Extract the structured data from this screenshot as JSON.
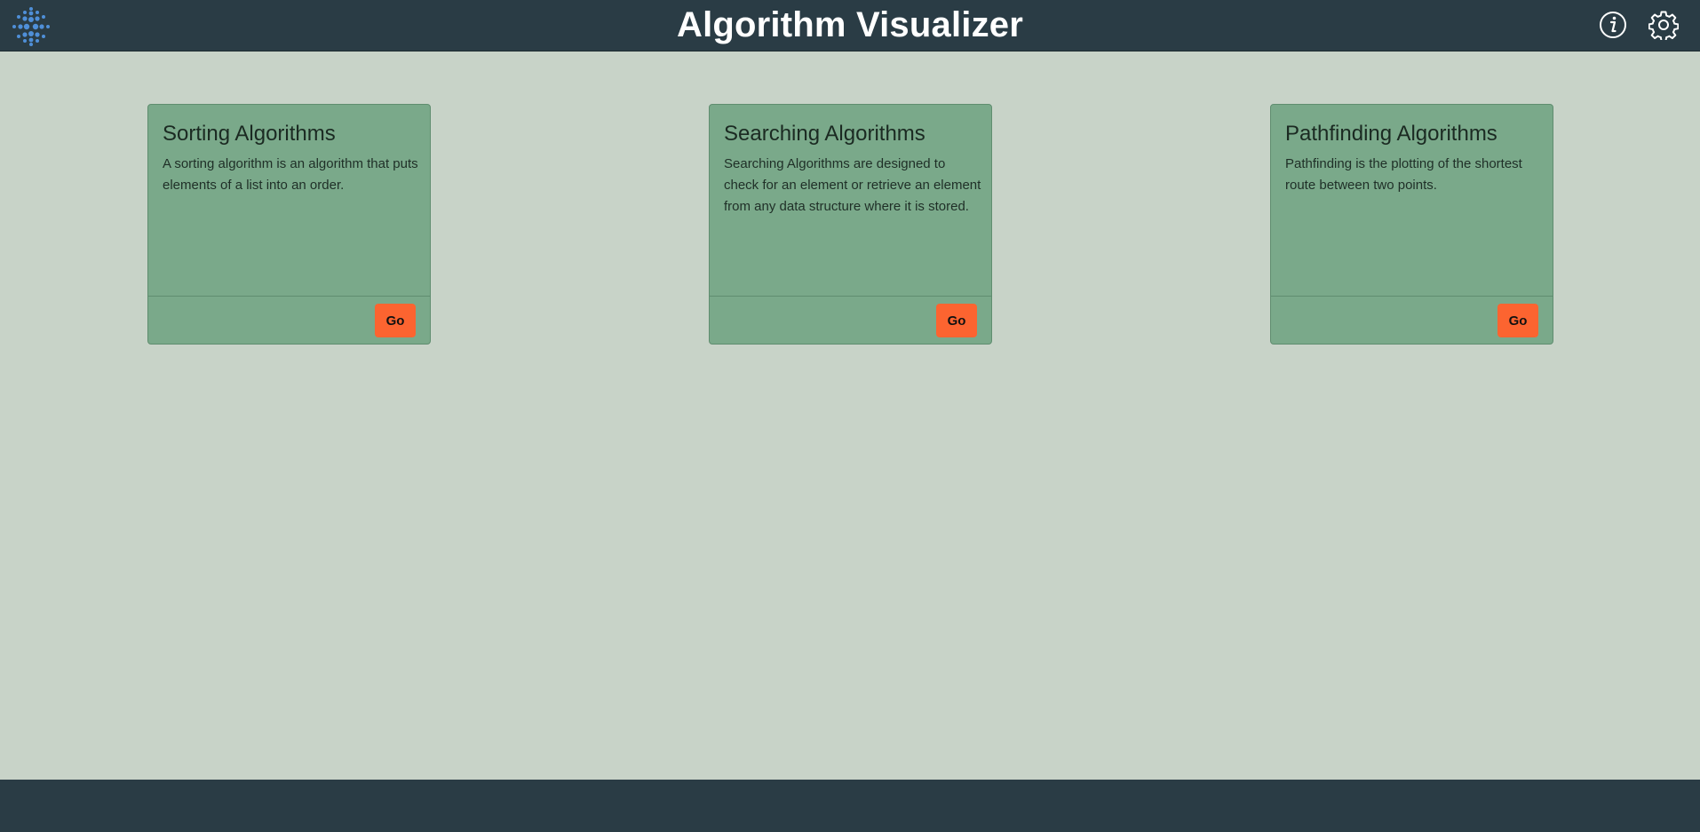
{
  "header": {
    "title": "Algorithm Visualizer",
    "logo_icon": "dot-grid-logo-icon",
    "info_icon": "info-icon",
    "settings_icon": "gear-icon"
  },
  "cards": [
    {
      "title": "Sorting Algorithms",
      "description": "A sorting algorithm is an algorithm that puts elements of a list into an order.",
      "button_label": "Go"
    },
    {
      "title": "Searching Algorithms",
      "description": "Searching Algorithms are designed to check for an element or retrieve an element from any data structure where it is stored.",
      "button_label": "Go"
    },
    {
      "title": "Pathfinding Algorithms",
      "description": "Pathfinding is the plotting of the shortest route between two points.",
      "button_label": "Go"
    }
  ],
  "colors": {
    "navbar": "#2a3c45",
    "background": "#c8d3c8",
    "card": "#7aa98a",
    "button": "#fc6430",
    "logo": "#4f8fd8"
  }
}
